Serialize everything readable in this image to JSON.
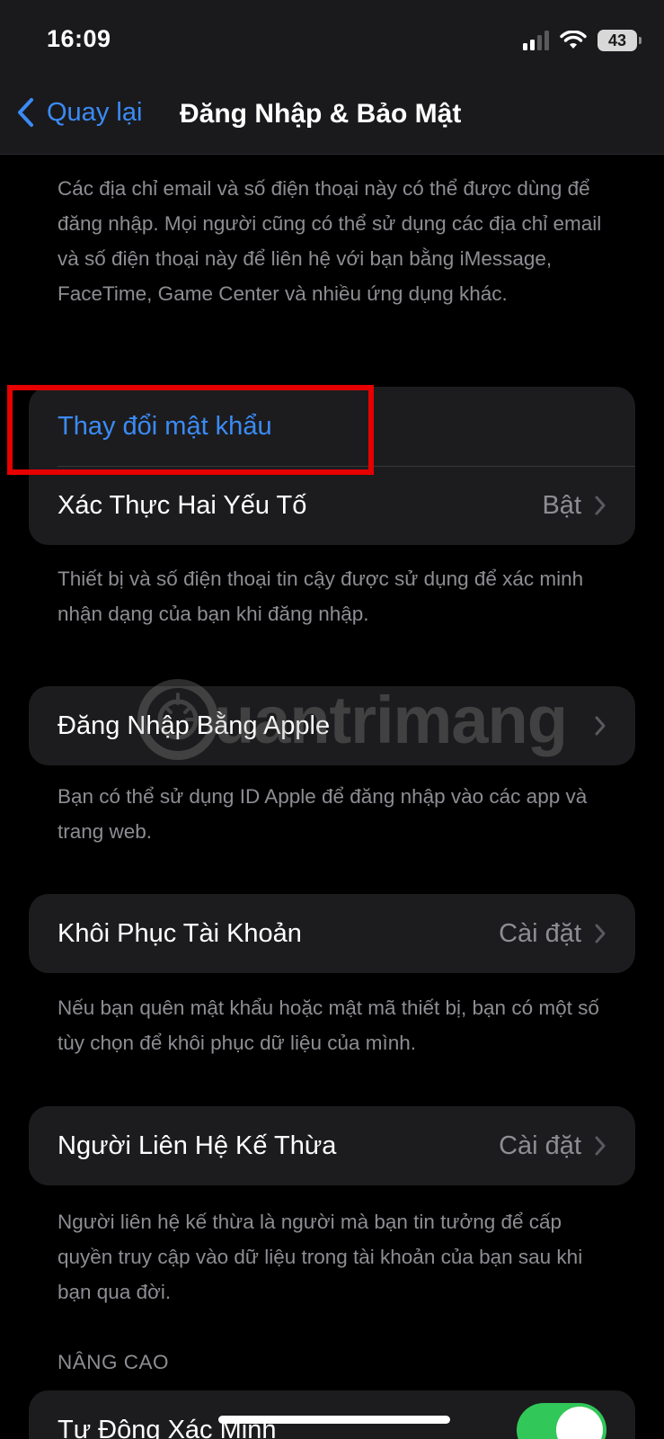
{
  "status": {
    "time": "16:09",
    "battery": "43"
  },
  "nav": {
    "back_label": "Quay lại",
    "title": "Đăng Nhập & Bảo Mật"
  },
  "intro_note": "Các địa chỉ email và số điện thoại này có thể được dùng để đăng nhập. Mọi người cũng có thể sử dụng các địa chỉ email và số điện thoại này để liên hệ với bạn bằng iMessage, FaceTime, Game Center và nhiều ứng dụng khác.",
  "security_group": {
    "change_password": "Thay đổi mật khẩu",
    "two_factor": {
      "label": "Xác Thực Hai Yếu Tố",
      "value": "Bật"
    },
    "note": "Thiết bị và số điện thoại tin cậy được sử dụng để xác minh nhận dạng của bạn khi đăng nhập."
  },
  "sign_in_apple": {
    "label": "Đăng Nhập Bằng Apple",
    "note": "Bạn có thể sử dụng ID Apple để đăng nhập vào các app và trang web."
  },
  "account_recovery": {
    "label": "Khôi Phục Tài Khoản",
    "value": "Cài đặt",
    "note": "Nếu bạn quên mật khẩu hoặc mật mã thiết bị, bạn có một số tùy chọn để khôi phục dữ liệu của mình."
  },
  "legacy_contact": {
    "label": "Người Liên Hệ Kế Thừa",
    "value": "Cài đặt",
    "note": "Người liên hệ kế thừa là người mà bạn tin tưởng để cấp quyền truy cập vào dữ liệu trong tài khoản của bạn sau khi bạn qua đời."
  },
  "advanced": {
    "header": "NÂNG CAO",
    "auto_verify": {
      "label": "Tự Động Xác Minh",
      "enabled": true
    }
  },
  "watermark": {
    "text": "uantrimang"
  },
  "colors": {
    "accent": "#3b8bf6",
    "highlight": "#e60000",
    "toggle_on": "#32c759"
  }
}
